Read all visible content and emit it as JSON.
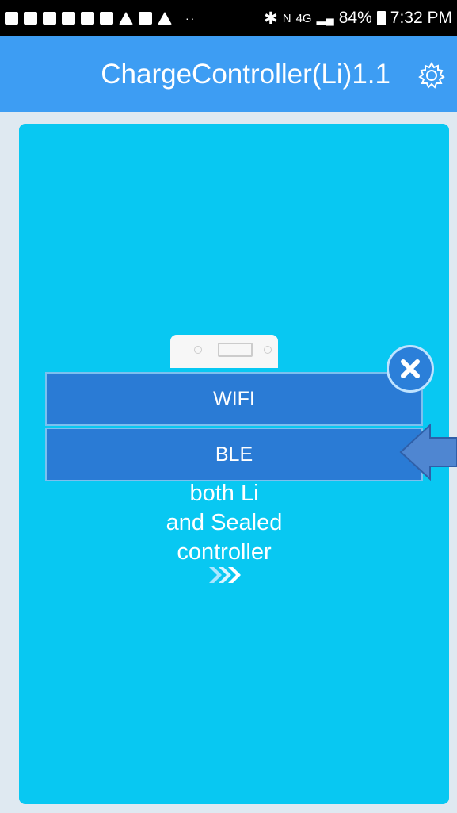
{
  "status_bar": {
    "signal_text": "4G",
    "battery_pct": "84%",
    "time": "7:32 PM"
  },
  "app_bar": {
    "title": "ChargeController(Li)1.1",
    "settings_icon": "gear-icon"
  },
  "main": {
    "description_lines": [
      "both Li",
      "and Sealed",
      "controller"
    ]
  },
  "dialog": {
    "options": [
      {
        "label": "WIFI"
      },
      {
        "label": "BLE"
      }
    ],
    "close_icon": "close-icon"
  },
  "colors": {
    "app_bar": "#3d9df3",
    "card": "#08c8f2",
    "button": "#2a7bd5",
    "arrow": "#4f86d1"
  }
}
